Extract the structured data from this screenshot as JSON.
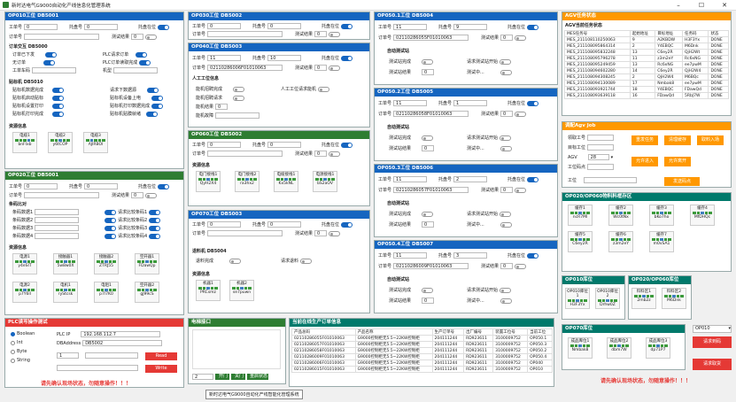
{
  "app": {
    "title": "新时达电气G9000自动化产线信息化管理系统",
    "tooltip": "新时达电气G9000自动化产线智能化管理系统"
  },
  "common": {
    "process_no": "工单号",
    "tray_no": "托盘号",
    "tray_present": "托盘在位",
    "order_no": "订单号",
    "test_result": "测试结果",
    "result_zero": "0",
    "process_val": "0",
    "tray_val": "0"
  },
  "op010": {
    "title": "OP010工位 DB5001",
    "order_section": "订单交互 DB5000",
    "order_labels": [
      "订单已下发",
      "无订单",
      "工单车码",
      "PLC请求订单",
      "PLC订单读取完成",
      "机型"
    ],
    "sticker_section": "贴标机 DB5010",
    "sticker_labels": [
      "贴标机数据完成",
      "贴标机启动贴标",
      "贴标机设置打印",
      "贴标机打印完成",
      "请求下数据源",
      "贴标机设备上电",
      "贴标机打印数据完成",
      "贴标机贴膜就绪"
    ],
    "res_section": "资源信息",
    "slots": [
      {
        "name": "电缆1",
        "code": "bnFlxb"
      },
      {
        "name": "电缆2",
        "code": "y6tCOP"
      },
      {
        "name": "电缆3",
        "code": "AJlRBOl"
      }
    ]
  },
  "op020": {
    "title": "OP020工位 DB5001",
    "scan_section": "条码比对",
    "scan_left": [
      "条码数据1",
      "条码数据2",
      "条码数据3",
      "条码数据4"
    ],
    "scan_right": [
      "请求比较条码1",
      "请求比较条码2",
      "请求比较条码3",
      "请求比较条码4"
    ],
    "res_section": "资源信息",
    "slots": [
      {
        "name": "电源1",
        "code": "y4eSIT"
      },
      {
        "name": "接触器1",
        "code": "5w8w0X"
      },
      {
        "name": "接触器2",
        "code": "ZTRJ55"
      },
      {
        "name": "空开器1",
        "code": "FDawQp"
      },
      {
        "name": "电源2",
        "code": "p7Y6ll"
      },
      {
        "name": "电机1",
        "code": "ryStcsk"
      },
      {
        "name": "电阻1",
        "code": "p7l7K0"
      },
      {
        "name": "空开器2",
        "code": "gJ99cS"
      }
    ]
  },
  "op030": {
    "title": "OP030工位 DB5002"
  },
  "op040": {
    "title": "OP040工位 DB5003",
    "process": "11",
    "tray": "10",
    "order": "02110286006F01010063",
    "section": "人工工位信息",
    "labels": [
      "能机招聘完成",
      "能机招聘请求",
      "能机结果",
      "能机故障"
    ],
    "right_label": "人工工位请求能机"
  },
  "op060": {
    "title": "OP060工位 DB5002",
    "res_section": "资源信息",
    "slots": [
      {
        "name": "电门接线1",
        "code": "QyH2X4"
      },
      {
        "name": "电门接线2",
        "code": "ra3hx2"
      },
      {
        "name": "电缆接线1",
        "code": "Kx5kNL"
      },
      {
        "name": "电源接线1",
        "code": "bS2aOV"
      }
    ]
  },
  "op070": {
    "title": "OP070工位 DB5003",
    "section": "退料机 DB5004",
    "labels": [
      "退料完成",
      "请求退料"
    ],
    "res_section": "资源信息",
    "slots": [
      {
        "name": "机器1",
        "code": "PRCsmz"
      },
      {
        "name": "机器2",
        "code": "se7puwn"
      }
    ]
  },
  "op050_1": {
    "title": "OP050.1工位 DB5004",
    "process": "11",
    "tray": "9",
    "order": "02110286055F01010063",
    "section": "自动测试站",
    "labels": [
      "测试站完成",
      "测试站结果",
      "请求测试站开始",
      "测试中..."
    ]
  },
  "op050_2": {
    "title": "OP050.2工位 DB5005",
    "process": "11",
    "tray": "1",
    "order": "02110286058F01010063",
    "section": "自动测试站",
    "labels": [
      "测试站完成",
      "测试站结果",
      "请求测试站开始",
      "测试中..."
    ]
  },
  "op050_3": {
    "title": "OP050.3工位 DB5006",
    "process": "11",
    "tray": "2",
    "order": "02110286057F01010063",
    "section": "自动测试站",
    "labels": [
      "测试站完成",
      "测试站结果",
      "请求测试站开始",
      "测试中..."
    ]
  },
  "op050_4": {
    "title": "OP050.4工位 DB5007",
    "process": "11",
    "tray": "3",
    "order": "02110286009F01010063",
    "section": "自动测试站",
    "labels": [
      "测试站完成",
      "测试站结果",
      "请求测试站开始",
      "测试中..."
    ]
  },
  "agv": {
    "title": "AGV任务状态",
    "sub": "AGV当前任务状态",
    "headers": [
      "MES任务号",
      "起始地址",
      "目标地址",
      "任务码",
      "状态"
    ],
    "rows": [
      [
        "MES_211108110250063",
        "9",
        "A2KBDW",
        "H3F3Yx",
        "DONE"
      ],
      [
        "MES_211108095864314",
        "2",
        "Y4EBQC",
        "M6Dnk",
        "DONE"
      ],
      [
        "MES_211108095832248",
        "13",
        "C6ey2R",
        "QjH2Wt",
        "DONE"
      ],
      [
        "MES_211108095796278",
        "11",
        "z3m2eY",
        "Rc6xNG",
        "DONE"
      ],
      [
        "MES_211108095249459",
        "13",
        "Rc6xNG",
        "ee7pwM",
        "DONE"
      ],
      [
        "MES_211108094602280",
        "14",
        "C6ey2R",
        "QjH2W4",
        "DONE"
      ],
      [
        "MES_211108094308245",
        "2",
        "QjH2W4",
        "M6BQc",
        "DONE"
      ],
      [
        "MES_211108094130089",
        "17",
        "Nmbak8",
        "ee7pwM",
        "DONE"
      ],
      [
        "MES_211108093921744",
        "18",
        "Y4EBQC",
        "FDawQd",
        "DONE"
      ],
      [
        "MES_211108093639118",
        "16",
        "FDawQd",
        "5RbJ7W",
        "DONE"
      ]
    ]
  },
  "agv_job": {
    "title": "调配Agv Job",
    "labels": [
      "领取工号",
      "目标工位",
      "AGV",
      "工位码点",
      "工位"
    ],
    "agv_val": "28",
    "btns": [
      "重发任务",
      "清理缓存",
      "取料入场",
      "允许进入",
      "允许离开",
      "发送码点"
    ]
  },
  "op020_060": {
    "title": "OP020/OP060物料料框存区",
    "slots": [
      {
        "name": "缓存1",
        "code": "ncR7Ml"
      },
      {
        "name": "缓存2",
        "code": "Wc0tNx"
      },
      {
        "name": "缓存3",
        "code": "bKo7ho"
      },
      {
        "name": "缓存4",
        "code": "MfDHQc"
      },
      {
        "name": "缓存5",
        "code": "C6ey2R"
      },
      {
        "name": "缓存6",
        "code": "z3m2eY"
      },
      {
        "name": "缓存7",
        "code": "m0vSA1"
      }
    ]
  },
  "op010_box": {
    "title": "OP010库位",
    "slots": [
      {
        "name": "OP010库位1",
        "code": "H3F3Yx"
      },
      {
        "name": "OP010库位2",
        "code": "Drhw0Z"
      }
    ]
  },
  "op020_060_box": {
    "title": "OP020/OP060库位",
    "slots": [
      {
        "name": "料料区1",
        "code": "2mb2z"
      },
      {
        "name": "料料区2",
        "code": "M6Dnk"
      }
    ]
  },
  "op070_box": {
    "title": "OP070库位",
    "slots": [
      {
        "name": "成品库位1",
        "code": "Nmbak8"
      },
      {
        "name": "成品库位2",
        "code": "dbm7W"
      },
      {
        "name": "成品库位3",
        "code": "dp71P7"
      }
    ],
    "select": "OP010",
    "btn1": "请求到码",
    "btn2": "请求取货"
  },
  "plc": {
    "title": "PLC读写操作测试",
    "types": [
      "Boolean",
      "Int",
      "Byte",
      "String"
    ],
    "ip_label": "PLC IP",
    "ip": "192.168.112.7",
    "addr_label": "DBAddress",
    "addr": "DB5002",
    "val1": "1",
    "read": "Read",
    "write": "Write",
    "warn": "请先确认现场状态，勿随意操作！！！"
  },
  "serial": {
    "title": "电梯接口",
    "val": "2",
    "btns": [
      "开门",
      "关门",
      "重启状态"
    ]
  },
  "orders": {
    "title": "当前在线生产订单信息",
    "headers": [
      "产品总码",
      "产品名称",
      "生产订单号",
      "出厂编号",
      "装置工位号",
      "当前工位"
    ],
    "rows": [
      [
        "02110286055F01010063",
        "G9000控制柜无5.5~22KW控制柜",
        "204111244",
        "RD923611",
        "3100009752",
        "OP050.1"
      ],
      [
        "02110286057F01010063",
        "G9000控制柜无5.5~22KW控制柜",
        "204111244",
        "RD923611",
        "3100009752",
        "OP050.3"
      ],
      [
        "02110286058F01010063",
        "G9000控制柜无5.5~22KW控制柜",
        "204111244",
        "RD923611",
        "3100009752",
        "OP050.2"
      ],
      [
        "02110286009F01010063",
        "G9000控制柜无5.5~22KW控制柜",
        "204111244",
        "RD923611",
        "3100009752",
        "OP050.4"
      ],
      [
        "02110286006F01010063",
        "G9000控制柜无5.5~22KW控制柜",
        "204111244",
        "RD923611",
        "3100009752",
        "OP040"
      ],
      [
        "02110286015F01010063",
        "G9000控制柜无5.5~22KW控制柜",
        "204111244",
        "RD923611",
        "3100009752",
        "OP010"
      ]
    ]
  },
  "warn_right": "请先确认现场状态，勿随意操作！！！"
}
